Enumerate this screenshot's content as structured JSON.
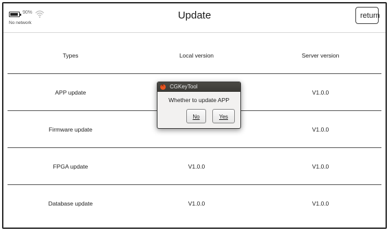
{
  "header": {
    "battery_percent": "90%",
    "network_status": "No network",
    "title": "Update",
    "return_label": "return"
  },
  "table": {
    "headers": [
      "Types",
      "Local version",
      "Server version"
    ],
    "rows": [
      {
        "type": "APP update",
        "local": "",
        "server": "V1.0.0"
      },
      {
        "type": "Firmware update",
        "local": "",
        "server": "V1.0.0"
      },
      {
        "type": "FPGA update",
        "local": "V1.0.0",
        "server": "V1.0.0"
      },
      {
        "type": "Database update",
        "local": "V1.0.0",
        "server": "V1.0.0"
      }
    ]
  },
  "dialog": {
    "title": "CGKeyTool",
    "message": "Whether to update APP",
    "no_label": "No",
    "yes_label": "Yes"
  },
  "icons": {
    "battery": "battery-icon",
    "wifi": "wifi-icon",
    "close": "close-icon"
  },
  "colors": {
    "dialog_close": "#e95420",
    "dialog_titlebar": "#3a3935"
  }
}
